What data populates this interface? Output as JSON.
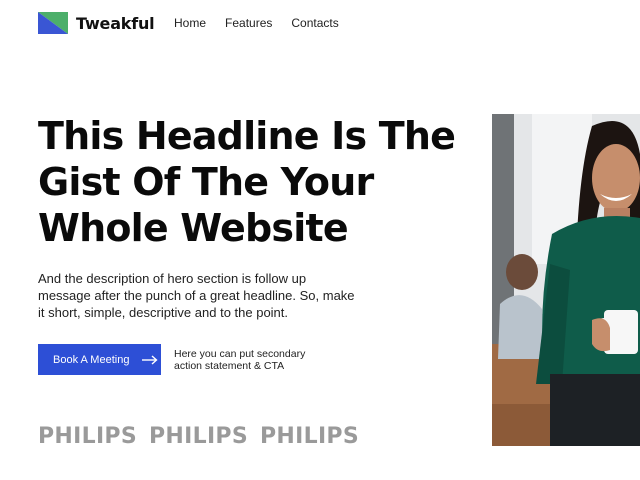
{
  "header": {
    "brand": "Tweakful",
    "nav": [
      "Home",
      "Features",
      "Contacts"
    ]
  },
  "hero": {
    "headline_lines": [
      "This Headline Is The",
      "Gist Of The Your",
      "Whole Website"
    ],
    "description": "And the description of hero section is follow up message after the punch of a great headline. So, make it short, simple, descriptive and to the point.",
    "cta_label": "Book A Meeting",
    "secondary_text": "Here you can put secondary action statement & CTA"
  },
  "logos": [
    "PHILIPS",
    "PHILIPS",
    "PHILIPS"
  ],
  "colors": {
    "accent": "#2d4fd6",
    "logo_green": "#4caf6a",
    "logo_blue": "#3a56d4",
    "sweater": "#0f5c4a"
  },
  "icons": {
    "cta": "arrow-right-icon",
    "logo": "brand-logo-icon"
  }
}
